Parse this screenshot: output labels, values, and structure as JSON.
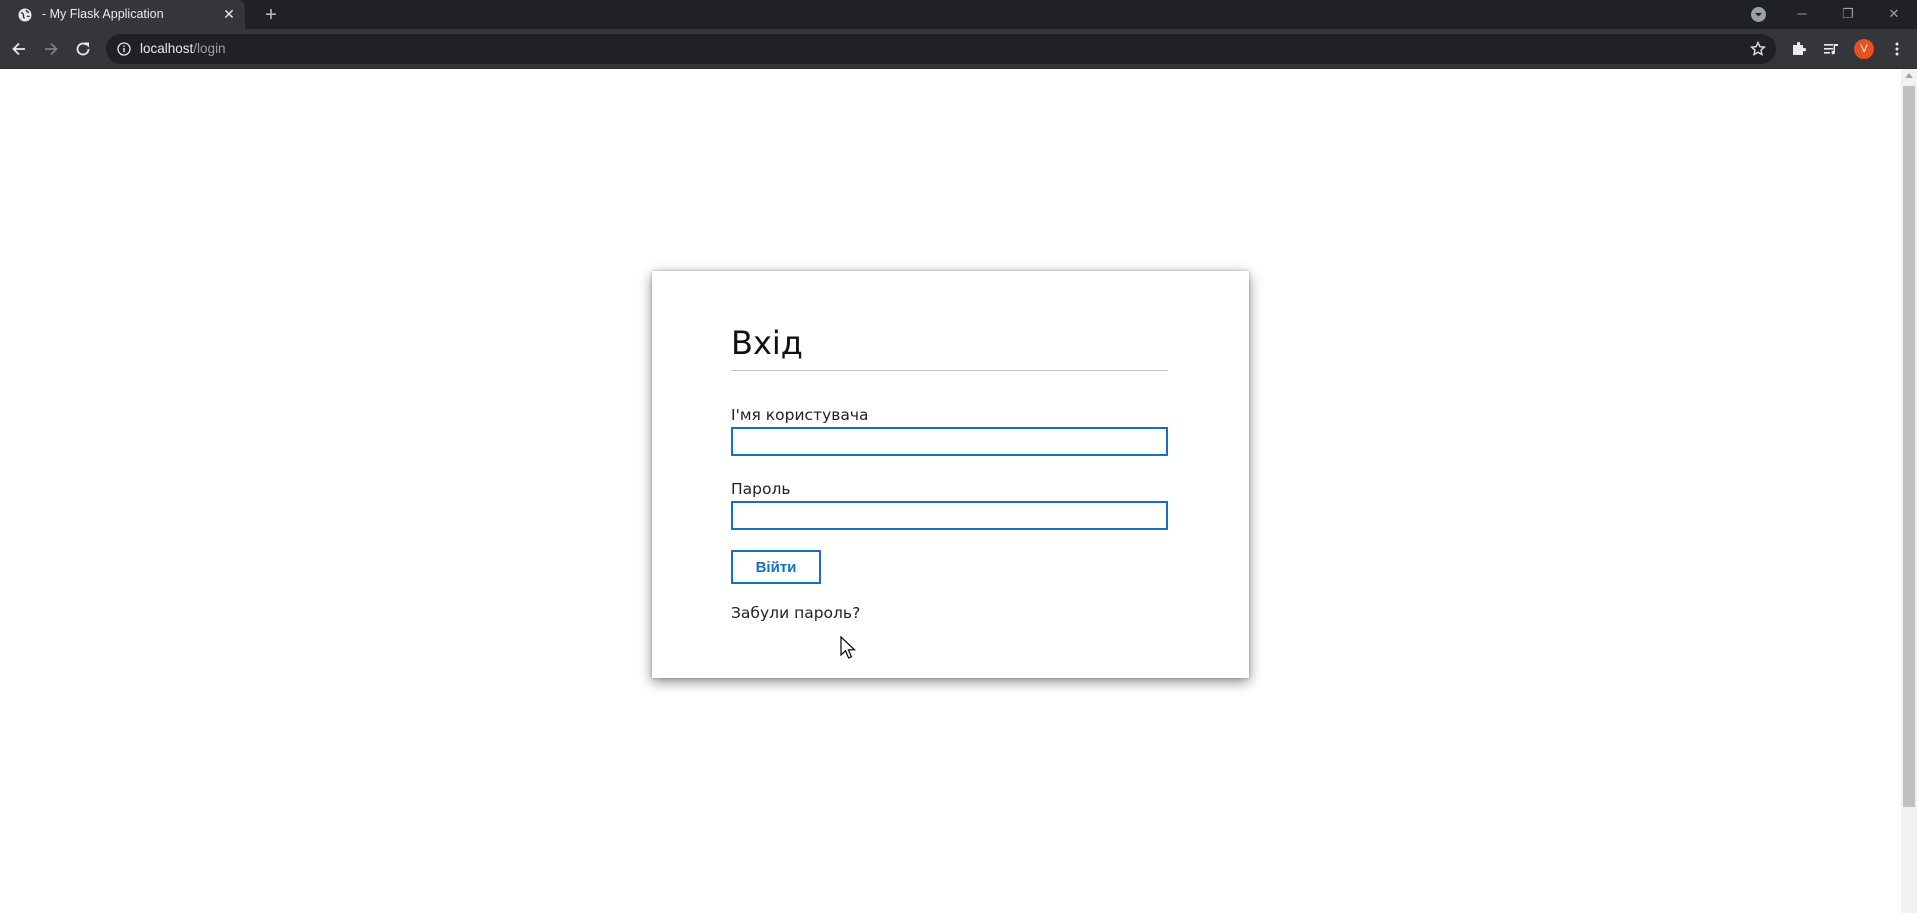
{
  "browser": {
    "tab": {
      "title": "- My Flask Application",
      "close_glyph": "✕",
      "favicon": "globe-icon"
    },
    "new_tab_glyph": "+",
    "address": {
      "host": "localhost",
      "path": "/login"
    },
    "window_controls": {
      "minimize": "─",
      "restore": "❐",
      "close": "✕"
    },
    "profile_initial": "V",
    "accent_profile_color": "#e8501f"
  },
  "login": {
    "title": "Вхід",
    "username_label": "І'мя користувача",
    "password_label": "Пароль",
    "submit_label": "Війти",
    "forgot_link": "Забули пароль?",
    "accent_color": "#1a6fbd"
  }
}
